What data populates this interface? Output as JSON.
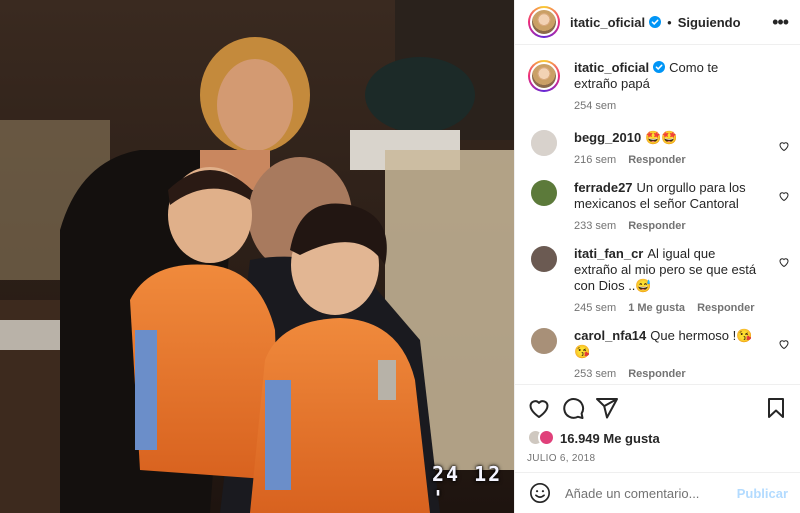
{
  "post": {
    "username": "itatic_oficial",
    "follow_status": "Siguiendo",
    "date_stamp": "24 12 '",
    "likes": "16.949",
    "likes_suffix": "Me gusta",
    "date": "JULIO 6, 2018",
    "caption_text": "Como te extraño papá",
    "caption_age": "254 sem"
  },
  "comments": [
    {
      "username": "begg_2010",
      "text": "🤩🤩",
      "age": "216 sem",
      "likes": "",
      "reply": "Responder",
      "avatar_color": "#d8d2cc"
    },
    {
      "username": "ferrade27",
      "text": "Un orgullo para los mexicanos el señor Cantoral",
      "age": "233 sem",
      "likes": "",
      "reply": "Responder",
      "avatar_color": "#5c7a3a"
    },
    {
      "username": "itati_fan_cr",
      "text": "Al igual que extraño al mio pero se que está con Dios ..😅",
      "age": "245 sem",
      "likes": "1 Me gusta",
      "reply": "Responder",
      "avatar_color": "#6b5a52"
    },
    {
      "username": "carol_nfa14",
      "text": "Que hermoso !😘😘",
      "age": "253 sem",
      "likes": "",
      "reply": "Responder",
      "avatar_color": "#a89078"
    }
  ],
  "composer": {
    "placeholder": "Añade un comentario...",
    "publish": "Publicar"
  },
  "icons": {
    "verified": "verified-badge-icon",
    "more": "more-options-icon",
    "heart": "heart-icon",
    "comment": "comment-icon",
    "share": "share-icon",
    "bookmark": "bookmark-icon",
    "emoji": "emoji-icon"
  },
  "colors": {
    "verified": "#0095f6",
    "publish_disabled": "#b3dbff",
    "meta": "#737373"
  }
}
